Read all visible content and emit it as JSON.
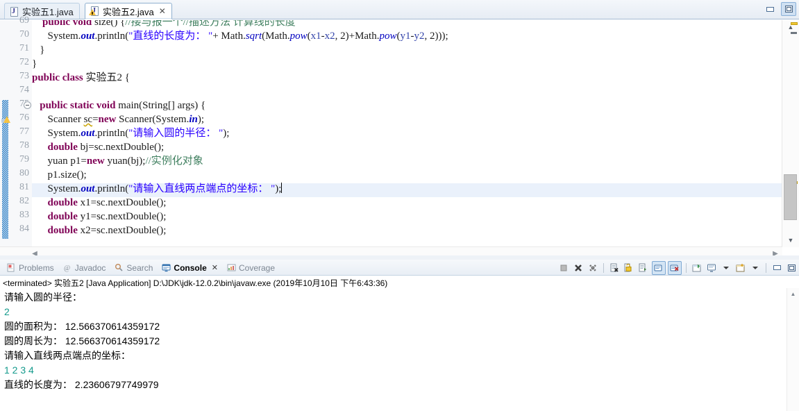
{
  "window": {
    "minimize_label": "Minimize",
    "maximize_label": "Maximize"
  },
  "editor": {
    "tabs": [
      {
        "label": "实验五1.java",
        "active": false,
        "has_warning": false,
        "closable": false
      },
      {
        "label": "实验五2.java",
        "active": true,
        "has_warning": true,
        "closable": true,
        "close_glyph": "✕"
      }
    ],
    "first_visible_line": 69,
    "cursor_line": 81,
    "lines": [
      {
        "num": "69",
        "partial_top": true,
        "fold": false,
        "warn": false,
        "change": false,
        "html": "    <span class='kw'>public void</span> size() {<span class='cmt'>//接与报一个//描述方法 计算线的长度</span>"
      },
      {
        "num": "70",
        "fold": false,
        "warn": false,
        "change": false,
        "html": "      System.<span class='fld'>out</span>.println(<span class='str'>\"直线的长度为： \"</span>+ Math.<span class='sfld'>sqrt</span>(Math.<span class='sfld'>pow</span>(<span class='loc'>x1</span>-<span class='loc'>x2</span>, 2)+Math.<span class='sfld'>pow</span>(<span class='loc'>y1</span>-<span class='loc'>y2</span>, 2)));"
      },
      {
        "num": "71",
        "fold": false,
        "warn": false,
        "change": false,
        "html": "   }"
      },
      {
        "num": "72",
        "fold": false,
        "warn": false,
        "change": false,
        "html": "}"
      },
      {
        "num": "73",
        "fold": false,
        "warn": false,
        "change": false,
        "html": "<span class='kw'>public class</span> 实验五2 {"
      },
      {
        "num": "74",
        "fold": false,
        "warn": false,
        "change": false,
        "html": ""
      },
      {
        "num": "75",
        "fold": true,
        "warn": false,
        "change": true,
        "html": "   <span class='kw'>public static void</span> main(String[] args) {"
      },
      {
        "num": "76",
        "fold": false,
        "warn": true,
        "change": true,
        "html": "      Scanner <span class='err-underline'>sc</span>=<span class='kw'>new</span> Scanner(System.<span class='fld'>in</span>);"
      },
      {
        "num": "77",
        "fold": false,
        "warn": false,
        "change": true,
        "html": "      System.<span class='fld'>out</span>.println(<span class='str'>\"请输入圆的半径： \"</span>);"
      },
      {
        "num": "78",
        "fold": false,
        "warn": false,
        "change": true,
        "html": "      <span class='kw'>double</span> bj=sc.nextDouble();"
      },
      {
        "num": "79",
        "fold": false,
        "warn": false,
        "change": true,
        "html": "      yuan p1=<span class='kw'>new</span> yuan(bj);<span class='cmt'>//实例化对象</span>"
      },
      {
        "num": "80",
        "fold": false,
        "warn": false,
        "change": true,
        "html": "      p1.size();"
      },
      {
        "num": "81",
        "fold": false,
        "warn": false,
        "change": true,
        "highlight": true,
        "html": "      System.<span class='fld'>out</span>.println(<span class='str'>\"请输入直线两点端点的坐标： \"</span>);<span class='caret'></span>"
      },
      {
        "num": "82",
        "fold": false,
        "warn": false,
        "change": true,
        "html": "      <span class='kw'>double</span> x1=sc.nextDouble();"
      },
      {
        "num": "83",
        "fold": false,
        "warn": false,
        "change": true,
        "html": "      <span class='kw'>double</span> y1=sc.nextDouble();"
      },
      {
        "num": "84",
        "fold": false,
        "warn": false,
        "change": true,
        "html": "      <span class='kw'>double</span> x2=sc.nextDouble();"
      }
    ]
  },
  "console": {
    "tabs": [
      {
        "label": "Problems",
        "icon": "problems-icon",
        "active": false
      },
      {
        "label": "Javadoc",
        "icon": "javadoc-icon",
        "active": false
      },
      {
        "label": "Search",
        "icon": "search-icon",
        "active": false
      },
      {
        "label": "Console",
        "icon": "console-icon",
        "active": true,
        "close_glyph": "✕"
      },
      {
        "label": "Coverage",
        "icon": "coverage-icon",
        "active": false
      }
    ],
    "toolbar": [
      {
        "name": "terminate-button",
        "enabled": false
      },
      {
        "name": "terminate-all-button",
        "enabled": true
      },
      {
        "name": "remove-all-terminated-button",
        "enabled": true
      },
      {
        "name": "clear-console-button",
        "enabled": true
      },
      {
        "name": "scroll-lock-button",
        "enabled": true
      },
      {
        "name": "word-wrap-button",
        "enabled": true
      },
      {
        "name": "show-console-on-output-button",
        "enabled": true,
        "toggled": true
      },
      {
        "name": "show-console-on-error-button",
        "enabled": true,
        "toggled": true
      },
      {
        "name": "pin-console-button",
        "enabled": true
      },
      {
        "name": "display-selected-console-button",
        "enabled": true,
        "has_dropdown": true
      },
      {
        "name": "open-console-button",
        "enabled": true,
        "has_dropdown": true
      },
      {
        "name": "minimize-button",
        "enabled": true
      },
      {
        "name": "maximize-button",
        "enabled": true
      }
    ],
    "launch_header": "<terminated> 实验五2 [Java Application] D:\\JDK\\jdk-12.0.2\\bin\\javaw.exe (2019年10月10日 下午6:43:36)",
    "output_lines": [
      {
        "text": "请输入圆的半径：",
        "kind": "out"
      },
      {
        "text": "2",
        "kind": "in"
      },
      {
        "text": "圆的面积为： 12.566370614359172",
        "kind": "out"
      },
      {
        "text": "圆的周长为： 12.566370614359172",
        "kind": "out"
      },
      {
        "text": "请输入直线两点端点的坐标：",
        "kind": "out"
      },
      {
        "text": "1 2 3 4",
        "kind": "in"
      },
      {
        "text": "直线的长度为： 2.23606797749979",
        "kind": "out"
      }
    ]
  },
  "colors": {
    "input_echo": "#149a8c",
    "keyword": "#7f0055",
    "string": "#2a00ff",
    "comment": "#3f7f5f",
    "field": "#0000c0",
    "change_bar": "#2f7fc4",
    "selection": "#eaf1fb"
  }
}
